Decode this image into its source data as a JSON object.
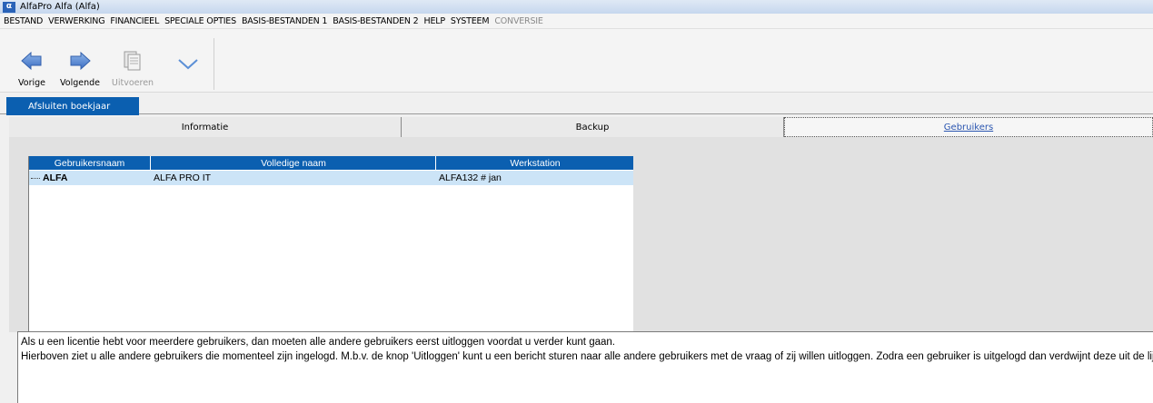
{
  "window": {
    "logo_text": "α",
    "title": "AlfaPro Alfa (Alfa)"
  },
  "menu": [
    {
      "label": "BESTAND",
      "disabled": false
    },
    {
      "label": "VERWERKING",
      "disabled": false
    },
    {
      "label": "FINANCIEEL",
      "disabled": false
    },
    {
      "label": "SPECIALE OPTIES",
      "disabled": false
    },
    {
      "label": "BASIS-BESTANDEN 1",
      "disabled": false
    },
    {
      "label": "BASIS-BESTANDEN 2",
      "disabled": false
    },
    {
      "label": "HELP",
      "disabled": false
    },
    {
      "label": "SYSTEEM",
      "disabled": false
    },
    {
      "label": "CONVERSIE",
      "disabled": true
    }
  ],
  "toolbar": {
    "prev_label": "Vorige",
    "next_label": "Volgende",
    "execute_label": "Uitvoeren",
    "prev_icon": "arrow-left-icon",
    "next_icon": "arrow-right-icon",
    "execute_icon": "document-icon",
    "more_icon": "chevron-down-icon"
  },
  "main_tab": {
    "label": "Afsluiten boekjaar"
  },
  "subtabs": {
    "items": [
      "Informatie",
      "Backup",
      "Gebruikers"
    ],
    "active": "Gebruikers"
  },
  "users_table": {
    "columns": [
      "Gebruikersnaam",
      "Volledige naam",
      "Werkstation"
    ],
    "rows": [
      {
        "username": "ALFA",
        "full_name": "ALFA PRO IT",
        "workstation": "ALFA132 # jan"
      }
    ]
  },
  "info": {
    "line1": "Als u een licentie hebt voor meerdere gebruikers, dan moeten alle andere gebruikers eerst uitloggen voordat u verder kunt gaan.",
    "line2": "Hierboven ziet u alle andere gebruikers die momenteel zijn ingelogd. M.b.v. de knop 'Uitloggen' kunt u een bericht sturen naar alle andere gebruikers met de vraag of zij willen uitloggen. Zodra een gebruiker is uitgelogd dan verdwijnt deze uit de lijst."
  },
  "colors": {
    "accent": "#0b5fb0",
    "selected_row": "#cce4f7"
  }
}
